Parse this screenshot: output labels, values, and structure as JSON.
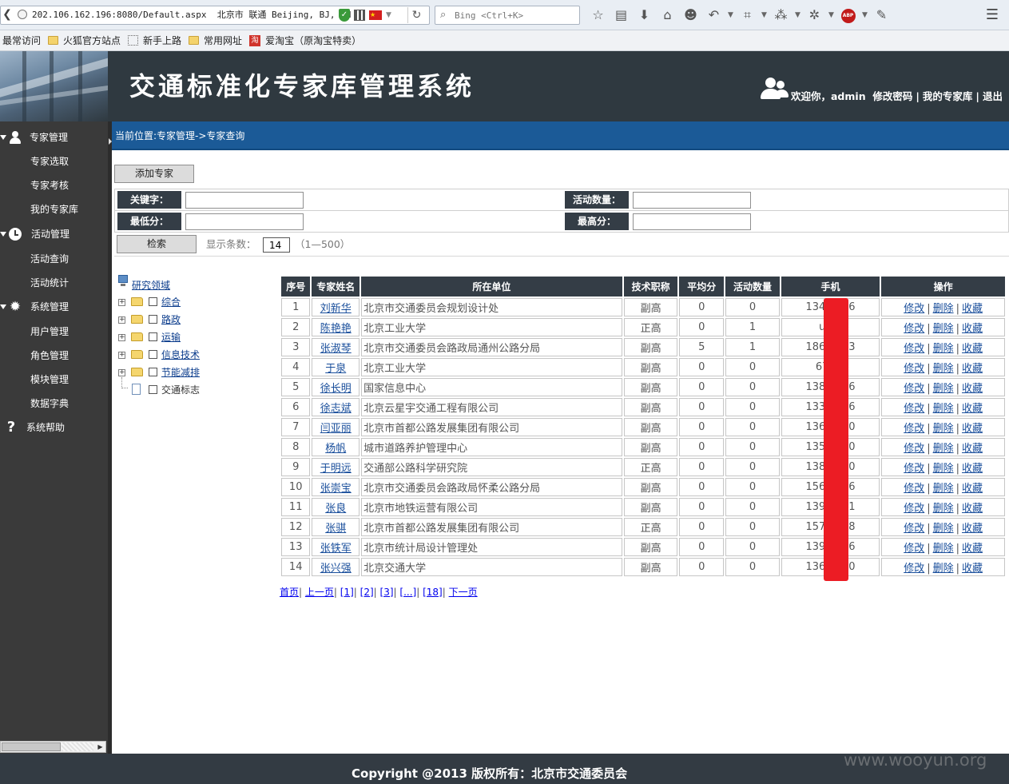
{
  "browser": {
    "url": "202.106.162.196:8080/Default.aspx",
    "location_info": "北京市 联通  Beijing, BJ, CN",
    "search_placeholder": "Bing <Ctrl+K>",
    "bookmarks": [
      "最常访问",
      "火狐官方站点",
      "新手上路",
      "常用网址",
      "爱淘宝（原淘宝特卖）"
    ],
    "taobao_glyph": "淘",
    "flag_glyph": "★",
    "shield_glyph": "✓",
    "toolbar_icons": [
      "star-icon",
      "reading-list-icon",
      "download-icon",
      "home-icon",
      "chat-icon",
      "undo-icon",
      "crop-icon",
      "translate-icon",
      "settings-icon",
      "adblock-icon",
      "extension-icon",
      "menu-icon"
    ]
  },
  "header": {
    "title": "交通标准化专家库管理系统",
    "welcome": "欢迎你，admin",
    "change_password": "修改密码",
    "my_experts": "我的专家库",
    "logout": "退出"
  },
  "sidebar": {
    "groups": [
      {
        "label": "专家管理",
        "icon": "user-icon",
        "items": [
          "专家选取",
          "专家考核",
          "我的专家库"
        ]
      },
      {
        "label": "活动管理",
        "icon": "clock-icon",
        "items": [
          "活动查询",
          "活动统计"
        ]
      },
      {
        "label": "系统管理",
        "icon": "gear-icon",
        "items": [
          "用户管理",
          "角色管理",
          "模块管理",
          "数据字典"
        ]
      },
      {
        "label": "系统帮助",
        "icon": "help-icon",
        "items": []
      }
    ]
  },
  "breadcrumb": "当前位置:专家管理->专家查询",
  "form": {
    "add_button": "添加专家",
    "keyword_label": "关键字：",
    "activity_count_label": "活动数量：",
    "min_score_label": "最低分：",
    "max_score_label": "最高分：",
    "keyword_value": "",
    "activity_count_value": "",
    "min_score_value": "",
    "max_score_value": "",
    "search_button": "检索",
    "count_label": "显示条数：",
    "count_value": "14",
    "count_range": "（1—500）"
  },
  "tree": {
    "root": "研究领域",
    "nodes": [
      {
        "label": "综合",
        "link": true
      },
      {
        "label": "路政",
        "link": true
      },
      {
        "label": "运输",
        "link": true
      },
      {
        "label": "信息技术",
        "link": true
      },
      {
        "label": "节能减排",
        "link": true
      },
      {
        "label": "交通标志",
        "link": false
      }
    ]
  },
  "table": {
    "columns": [
      "序号",
      "专家姓名",
      "所在单位",
      "技术职称",
      "平均分",
      "活动数量",
      "手机",
      "操作"
    ],
    "actions": [
      "修改",
      "删除",
      "收藏"
    ],
    "rows": [
      {
        "no": "1",
        "name": "刘新华",
        "unit": "北京市交通委员会规划设计处",
        "title": "副高",
        "avg": "0",
        "activities": "0",
        "phone": "1340     866"
      },
      {
        "no": "2",
        "name": "陈艳艳",
        "unit": "北京工业大学",
        "title": "正高",
        "avg": "0",
        "activities": "1",
        "phone": "un       d"
      },
      {
        "no": "3",
        "name": "张淑琴",
        "unit": "北京市交通委员会路政局通州公路分局",
        "title": "副高",
        "avg": "5",
        "activities": "1",
        "phone": "1861     923"
      },
      {
        "no": "4",
        "name": "于泉",
        "unit": "北京工业大学",
        "title": "副高",
        "avg": "0",
        "activities": "0",
        "phone": "67      09"
      },
      {
        "no": "5",
        "name": "徐长明",
        "unit": "国家信息中心",
        "title": "副高",
        "avg": "0",
        "activities": "0",
        "phone": "1380     456"
      },
      {
        "no": "6",
        "name": "徐志斌",
        "unit": "北京云星宇交通工程有限公司",
        "title": "副高",
        "avg": "0",
        "activities": "0",
        "phone": "1330     916"
      },
      {
        "no": "7",
        "name": "闫亚丽",
        "unit": "北京市首都公路发展集团有限公司",
        "title": "副高",
        "avg": "0",
        "activities": "0",
        "phone": "1360     570"
      },
      {
        "no": "8",
        "name": "杨帆",
        "unit": "城市道路养护管理中心",
        "title": "副高",
        "avg": "0",
        "activities": "0",
        "phone": "1350     570"
      },
      {
        "no": "9",
        "name": "于明远",
        "unit": "交通部公路科学研究院",
        "title": "正高",
        "avg": "0",
        "activities": "0",
        "phone": "1380     160"
      },
      {
        "no": "10",
        "name": "张崇宝",
        "unit": "北京市交通委员会路政局怀柔公路分局",
        "title": "副高",
        "avg": "0",
        "activities": "0",
        "phone": "1560     216"
      },
      {
        "no": "11",
        "name": "张良",
        "unit": "北京市地铁运营有限公司",
        "title": "副高",
        "avg": "0",
        "activities": "0",
        "phone": "1390     571"
      },
      {
        "no": "12",
        "name": "张骐",
        "unit": "北京市首都公路发展集团有限公司",
        "title": "正高",
        "avg": "0",
        "activities": "0",
        "phone": "1571     788"
      },
      {
        "no": "13",
        "name": "张铁军",
        "unit": "北京市统计局设计管理处",
        "title": "副高",
        "avg": "0",
        "activities": "0",
        "phone": "1391     726"
      },
      {
        "no": "14",
        "name": "张兴强",
        "unit": "北京交通大学",
        "title": "副高",
        "avg": "0",
        "activities": "0",
        "phone": "1364     720"
      }
    ]
  },
  "pager": {
    "items": [
      "首页",
      "上一页",
      "[1]",
      "[2]",
      "[3]",
      "[...]",
      "[18]",
      "下一页"
    ]
  },
  "footer": "Copyright @2013   版权所有：北京市交通委员会",
  "watermark": "www.wooyun.org",
  "colors": {
    "header_bg": "#2f3940",
    "sidebar_bg": "#3a3a3a",
    "breadcrumb_bg": "#1b5a97",
    "table_header_bg": "#343d46",
    "link": "#1a4f9c",
    "redaction": "#ec1c24"
  }
}
